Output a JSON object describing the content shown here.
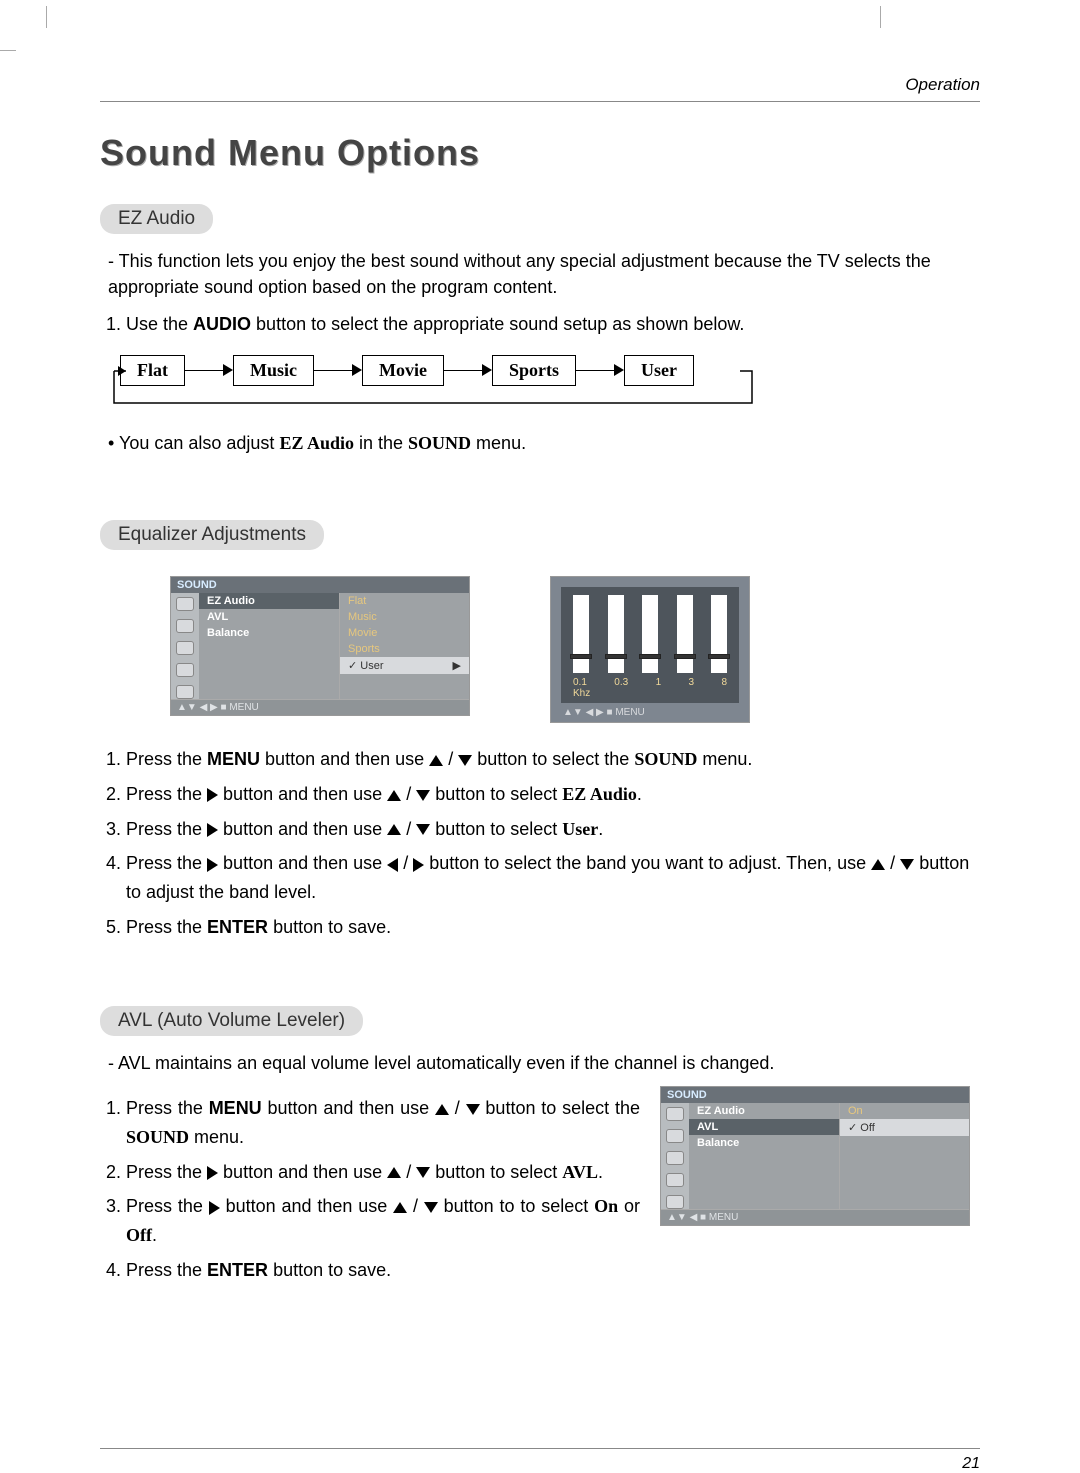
{
  "header": {
    "section": "Operation"
  },
  "title": "Sound Menu Options",
  "ez_audio": {
    "heading": "EZ Audio",
    "desc_prefix": "- This function lets you enjoy the best sound without any special adjustment because the TV selects the appropriate sound option based on the program content.",
    "step1_a": "Use the ",
    "step1_b": "AUDIO",
    "step1_c": " button to select the appropriate sound setup as shown below.",
    "flow": [
      "Flat",
      "Music",
      "Movie",
      "Sports",
      "User"
    ],
    "note_a": "• You can also adjust ",
    "note_b": "EZ Audio",
    "note_c": " in the ",
    "note_d": "SOUND",
    "note_e": " menu."
  },
  "equalizer": {
    "heading": "Equalizer Adjustments",
    "osd_title": "SOUND",
    "main_items": [
      "EZ Audio",
      "AVL",
      "Balance"
    ],
    "opt_items": [
      "Flat",
      "Music",
      "Movie",
      "Sports",
      "User"
    ],
    "osd_footer": "▲▼ ◀ ▶  ■ MENU",
    "eq_bands": [
      "0.1",
      "0.3",
      "1",
      "3",
      "8"
    ],
    "eq_khz": "Khz",
    "eq_footer": "▲▼ ◀ ▶  ■ MENU",
    "steps": {
      "s1_a": "Press the ",
      "s1_b": "MENU",
      "s1_c": " button and then use ",
      "s1_d": " button to select the ",
      "s1_e": "SOUND",
      "s1_f": " menu.",
      "s2_a": "Press the ",
      "s2_b": " button and then use ",
      "s2_c": " button to select ",
      "s2_d": "EZ Audio",
      "s2_e": ".",
      "s3_a": "Press the ",
      "s3_b": " button and then use ",
      "s3_c": " button to select ",
      "s3_d": "User",
      "s3_e": ".",
      "s4_a": "Press the ",
      "s4_b": " button and then use ",
      "s4_c": " button to select the band you want to adjust. Then, use ",
      "s4_d": " button to adjust the band level.",
      "s5_a": "Press the ",
      "s5_b": "ENTER",
      "s5_c": " button to save."
    }
  },
  "avl": {
    "heading": "AVL (Auto Volume Leveler)",
    "desc": "- AVL maintains an equal volume level automatically even if the channel is changed.",
    "steps": {
      "s1_a": "Press the ",
      "s1_b": "MENU",
      "s1_c": " button and then use ",
      "s1_d": " button to select the ",
      "s1_e": "SOUND",
      "s1_f": " menu.",
      "s2_a": "Press the ",
      "s2_b": " button and then use ",
      "s2_c": " button to select ",
      "s2_d": "AVL",
      "s2_e": ".",
      "s3_a": "Press the ",
      "s3_b": " button and then use ",
      "s3_c": " button to to select ",
      "s3_d": "On",
      "s3_e": " or ",
      "s3_f": "Off",
      "s3_g": ".",
      "s4_a": "Press the ",
      "s4_b": "ENTER",
      "s4_c": " button to save."
    },
    "osd_title": "SOUND",
    "main_items": [
      "EZ Audio",
      "AVL",
      "Balance"
    ],
    "opt_items": [
      "On",
      "Off"
    ],
    "osd_footer": "▲▼ ◀  ■ MENU"
  },
  "page_number": "21"
}
